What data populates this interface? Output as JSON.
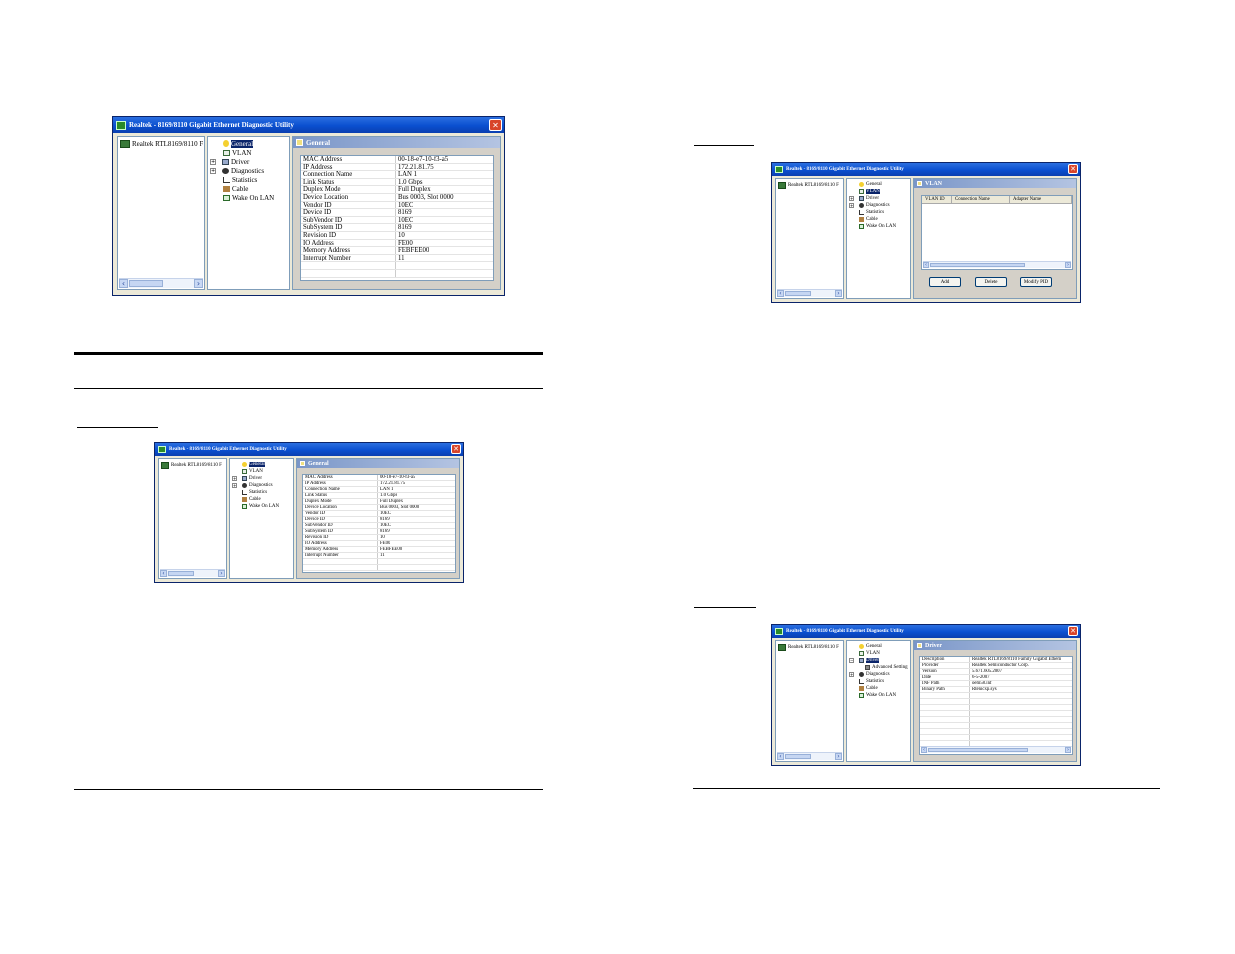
{
  "window_title": "Realtek - 8169/8110 Gigabit Ethernet Diagnostic Utility",
  "adapter_name": "Realtek RTL8169/8110 F",
  "tree": {
    "general": "General",
    "vlan": "VLAN",
    "driver": "Driver",
    "advanced_setting": "Advanced Setting",
    "diagnostics": "Diagnostics",
    "statistics": "Statistics",
    "cable": "Cable",
    "wake_on_lan": "Wake On LAN",
    "expand": "+",
    "collapse": "−"
  },
  "close_glyph": "✕",
  "scroll_left": "‹",
  "scroll_right": "›",
  "general": {
    "header": "General",
    "rows": [
      {
        "name": "MAC Address",
        "value": "00-18-e7-10-f3-a5"
      },
      {
        "name": "IP Address",
        "value": "172.21.81.75"
      },
      {
        "name": "Connection Name",
        "value": "LAN 1"
      },
      {
        "name": "Link Status",
        "value": "1.0 Gbps"
      },
      {
        "name": "Duplex Mode",
        "value": "Full Duplex"
      },
      {
        "name": "Device Location",
        "value": "Bus 0003, Slot 0000"
      },
      {
        "name": "Vendor ID",
        "value": "10EC"
      },
      {
        "name": "Device ID",
        "value": "8169"
      },
      {
        "name": "SubVendor ID",
        "value": "10EC"
      },
      {
        "name": "SubSystem ID",
        "value": "8169"
      },
      {
        "name": "Revision ID",
        "value": "10"
      },
      {
        "name": "IO Address",
        "value": "FE00"
      },
      {
        "name": "Memory Address",
        "value": "FEBFEE00"
      },
      {
        "name": "Interrupt Number",
        "value": "11"
      }
    ]
  },
  "general_small": {
    "header": "General",
    "rows": [
      {
        "name": "MAC Address",
        "value": "00-18-e7-10-f3-a5"
      },
      {
        "name": "IP Address",
        "value": "172.21.81.75"
      },
      {
        "name": "Connection Name",
        "value": "LAN 1"
      },
      {
        "name": "Link Status",
        "value": "1.0 Gbps"
      },
      {
        "name": "Duplex Mode",
        "value": "Full Duplex"
      },
      {
        "name": "Device Location",
        "value": "Bus 0003, Slot 0000"
      },
      {
        "name": "Vendor ID",
        "value": "10EC"
      },
      {
        "name": "Device ID",
        "value": "8169"
      },
      {
        "name": "SubVendor ID",
        "value": "10EC"
      },
      {
        "name": "SubSystem ID",
        "value": "8169"
      },
      {
        "name": "Revision ID",
        "value": "10"
      },
      {
        "name": "IO Address",
        "value": "FE00"
      },
      {
        "name": "Memory Address",
        "value": "FEBFEE00"
      },
      {
        "name": "Interrupt Number",
        "value": "11"
      }
    ]
  },
  "vlan": {
    "header": "VLAN",
    "columns": [
      "VLAN ID",
      "Connection Name",
      "Adapter Name"
    ],
    "buttons": {
      "add": "Add",
      "delete": "Delete",
      "modify": "Modify PID"
    }
  },
  "driver": {
    "header": "Driver",
    "rows": [
      {
        "name": "Description",
        "value": "Realtek RTL8169/8110 Family Gigabit Ethern"
      },
      {
        "name": "Provider",
        "value": "Realtek Semiconductor Corp."
      },
      {
        "name": "Version",
        "value": "5.671.605.2007"
      },
      {
        "name": "Date",
        "value": "6-5-2007"
      },
      {
        "name": "INF Path",
        "value": "oem58.inf"
      },
      {
        "name": "Binary Path",
        "value": "Rtenicxp.sys"
      }
    ]
  }
}
